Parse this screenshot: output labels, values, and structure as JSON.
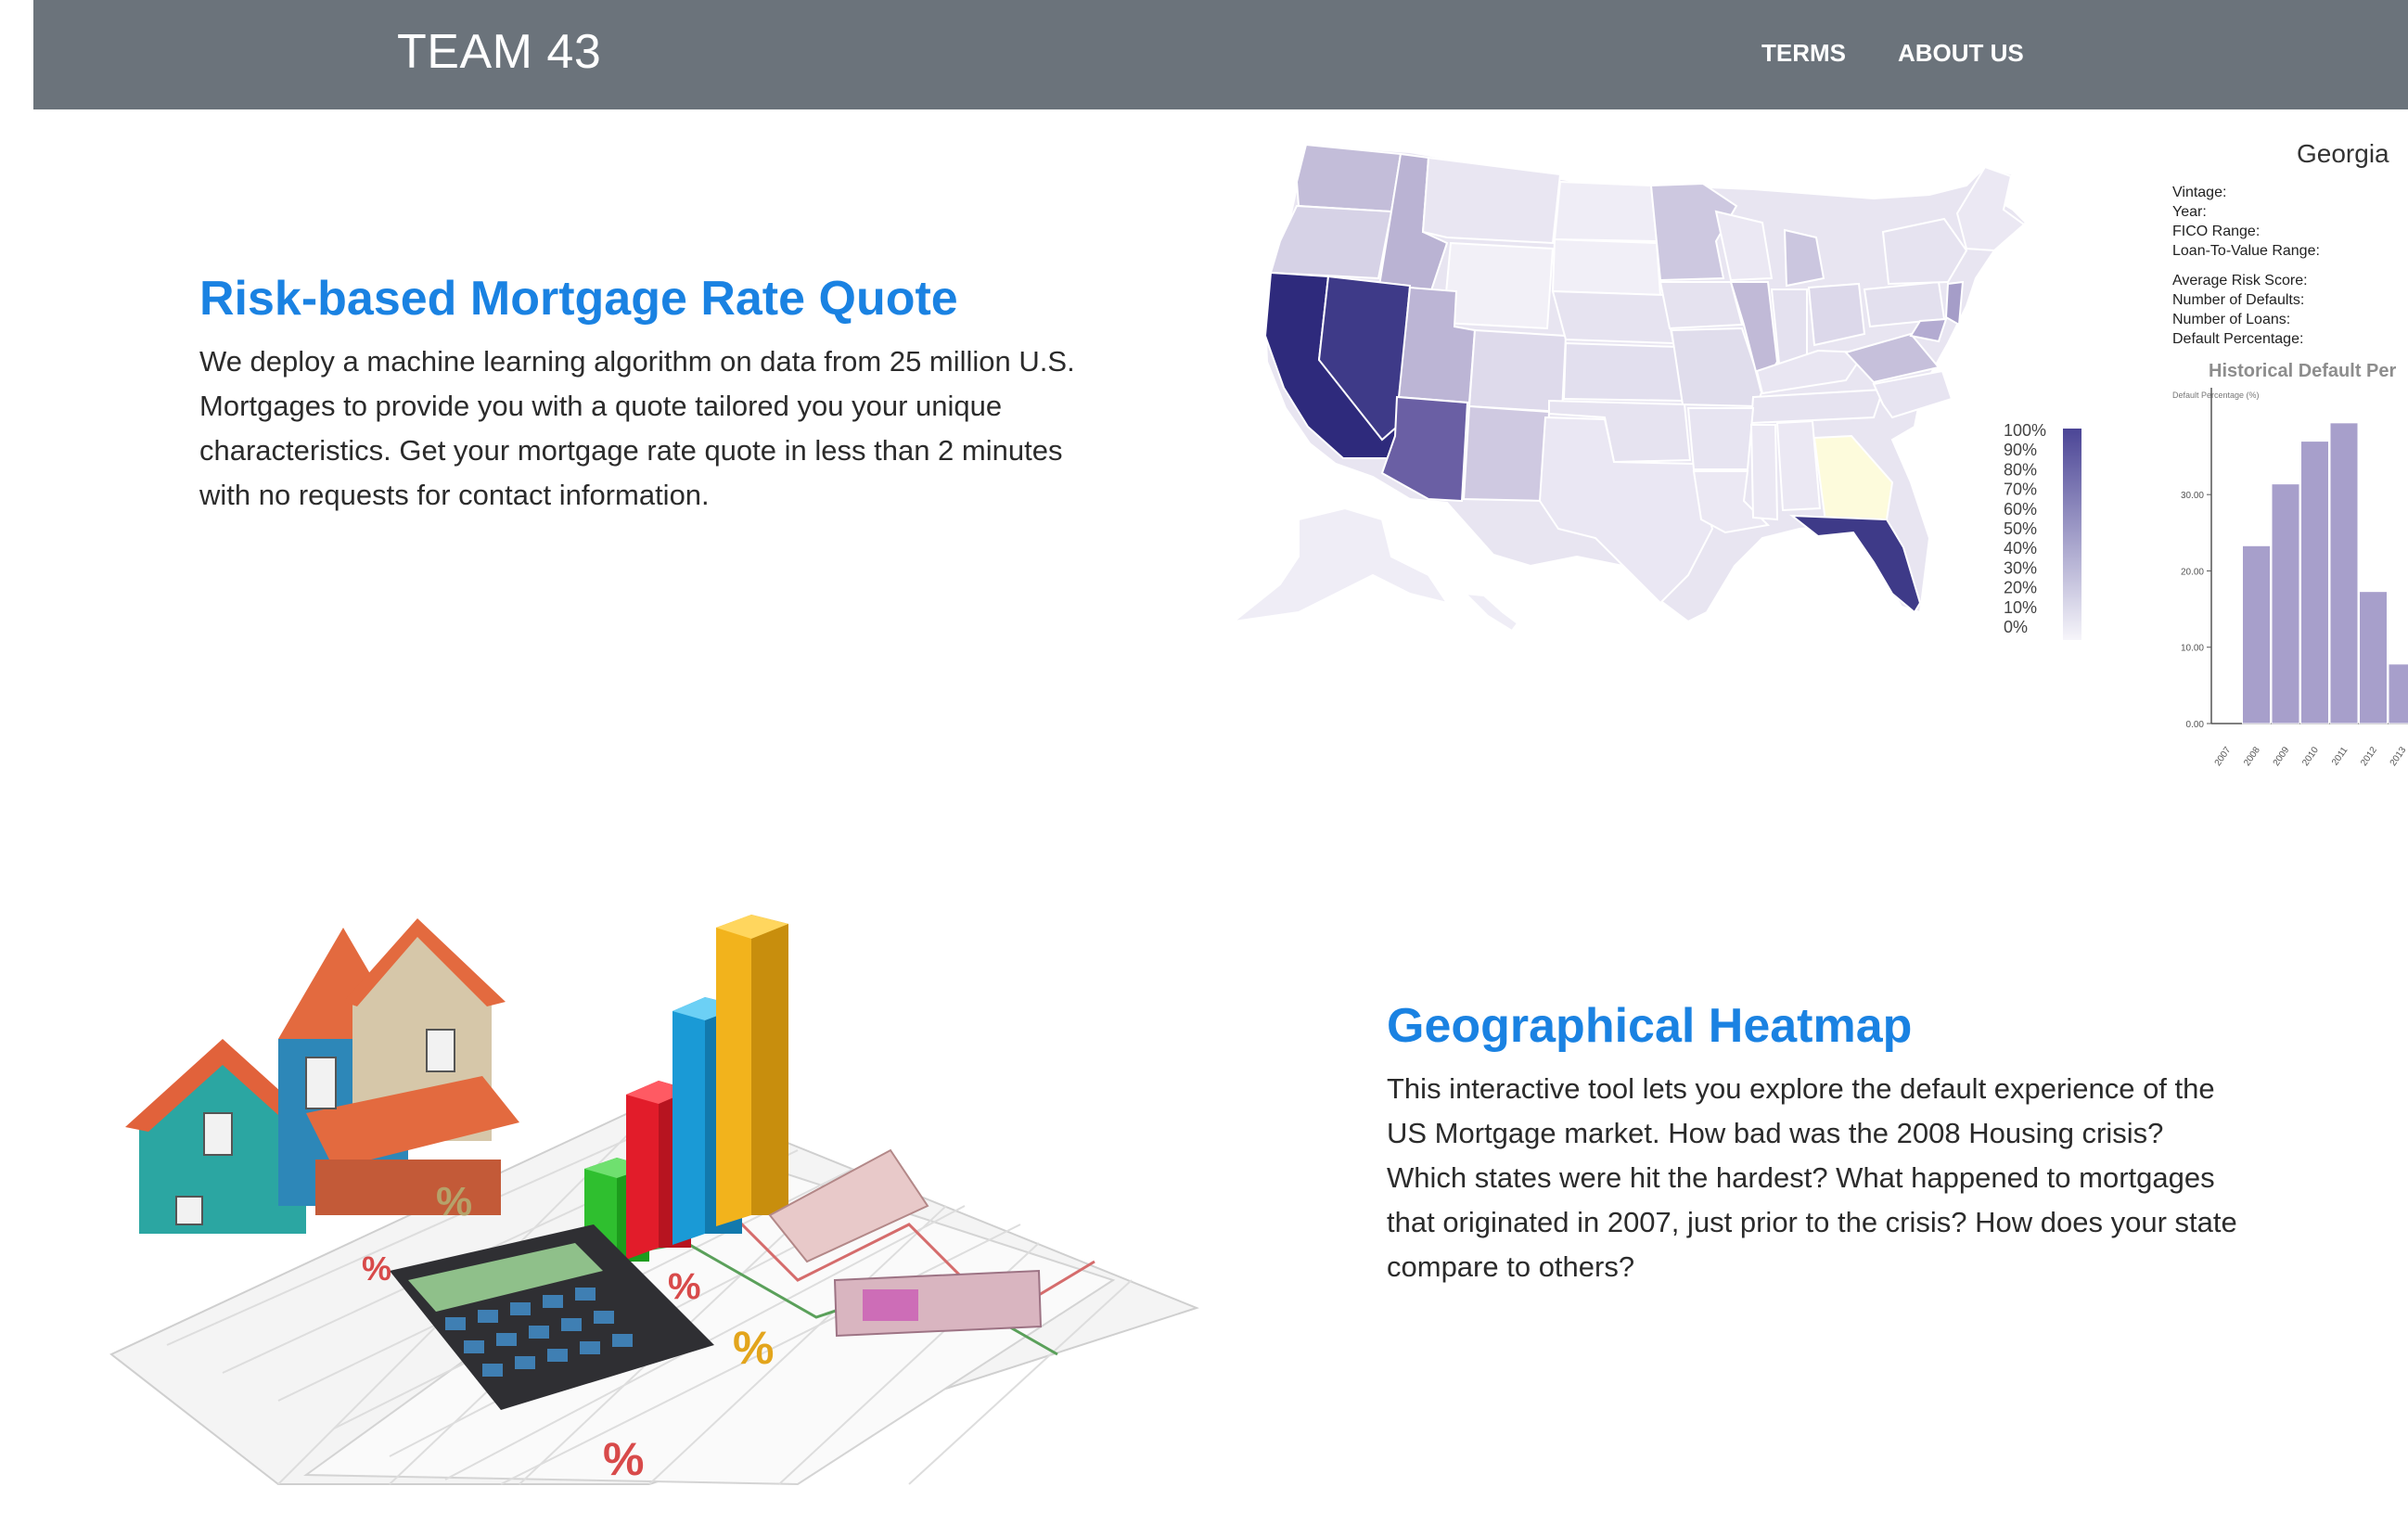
{
  "nav": {
    "brand": "TEAM 43",
    "links": [
      "TERMS",
      "ABOUT US"
    ]
  },
  "section1": {
    "title": "Risk-based Mortgage Rate Quote",
    "body": "We deploy a machine learning algorithm on data from 25 million U.S. Mortgages to provide you with a quote tailored you your unique characteristics. Get your mortgage rate quote in less than 2 minutes with no requests for contact information."
  },
  "section2": {
    "title": "Geographical Heatmap",
    "body": "This interactive tool lets you explore the default experience of the US Mortgage market. How bad was the 2008 Housing crisis? Which states were hit the hardest? What happened to mortgages that originated in 2007, just prior to the crisis? How does your state compare to others?"
  },
  "legend": [
    "100%",
    "90%",
    "80%",
    "70%",
    "60%",
    "50%",
    "40%",
    "30%",
    "20%",
    "10%",
    "0%"
  ],
  "panel": {
    "state": "Georgia",
    "fields_a": [
      "Vintage:",
      "Year:",
      "FICO Range:",
      "Loan-To-Value Range:"
    ],
    "fields_b": [
      "Average Risk Score:",
      "Number of Defaults:",
      "Number of Loans:",
      "Default Percentage:"
    ],
    "chart_title": "Historical Default Per",
    "ylabel": "Default Percentage (%)"
  },
  "chart_data": {
    "type": "bar",
    "title": "Historical Default Per",
    "ylabel": "Default Percentage (%)",
    "categories": [
      "2007",
      "2008",
      "2009",
      "2010",
      "2011",
      "2012",
      "2013"
    ],
    "values": [
      0,
      23.3,
      31.4,
      37,
      39.4,
      17.3,
      7.8
    ],
    "yticks": [
      "0.00",
      "10.00",
      "20.00",
      "30.00"
    ],
    "ylim": [
      0,
      44
    ]
  },
  "colors": {
    "navbar": "#6b737b",
    "accent": "#1a82e2",
    "georgia": "#fdfbdc",
    "map_dark": "#2d2a7a"
  }
}
